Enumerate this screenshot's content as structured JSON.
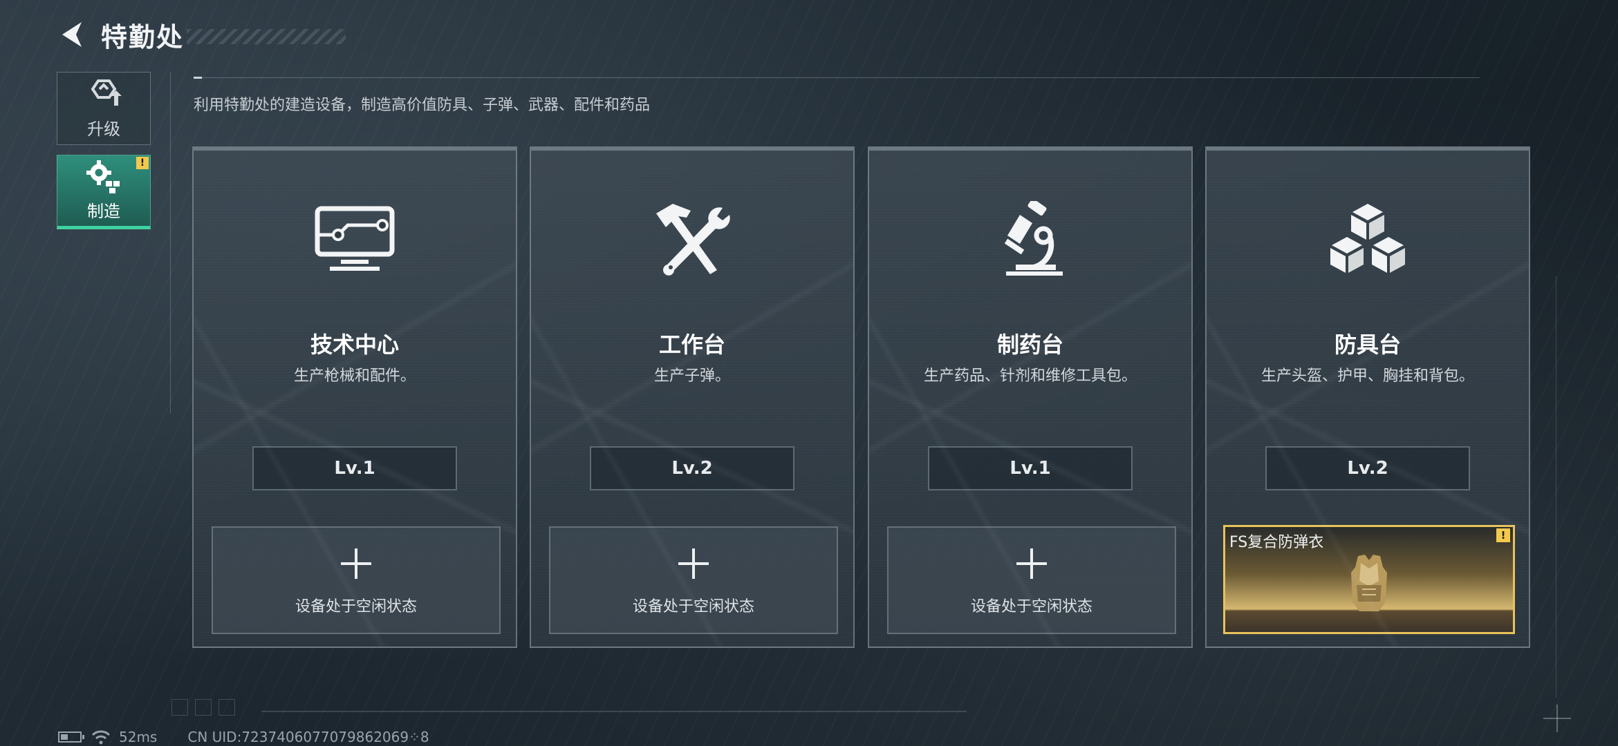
{
  "header": {
    "title": "特勤处"
  },
  "sidebar": {
    "tabs": [
      {
        "label": "升级",
        "icon": "upgrade-icon",
        "active": false
      },
      {
        "label": "制造",
        "icon": "gear-cubes-icon",
        "active": true,
        "alert": "!"
      }
    ]
  },
  "subtitle": "利用特勤处的建造设备，制造高价值防具、子弹、武器、配件和药品",
  "stations": [
    {
      "name": "技术中心",
      "desc": "生产枪械和配件。",
      "level": "Lv.1",
      "icon": "computer-icon",
      "slot": {
        "status": "idle",
        "text": "设备处于空闲状态"
      }
    },
    {
      "name": "工作台",
      "desc": "生产子弹。",
      "level": "Lv.2",
      "icon": "hammer-wrench-icon",
      "slot": {
        "status": "idle",
        "text": "设备处于空闲状态"
      }
    },
    {
      "name": "制药台",
      "desc": "生产药品、针剂和维修工具包。",
      "level": "Lv.1",
      "icon": "microscope-icon",
      "slot": {
        "status": "idle",
        "text": "设备处于空闲状态"
      }
    },
    {
      "name": "防具台",
      "desc": "生产头盔、护甲、胸挂和背包。",
      "level": "Lv.2",
      "icon": "cubes-icon",
      "slot": {
        "status": "producing",
        "item_name": "FS复合防弹衣",
        "alert": "!"
      }
    }
  ],
  "status_bar": {
    "ping": "52ms",
    "uid": "CN UID:7237406077079862069⁘8"
  },
  "colors": {
    "accent_green": "#3fd1a0",
    "alert_yellow": "#f2c94c",
    "product_gold": "#e8c35a"
  }
}
